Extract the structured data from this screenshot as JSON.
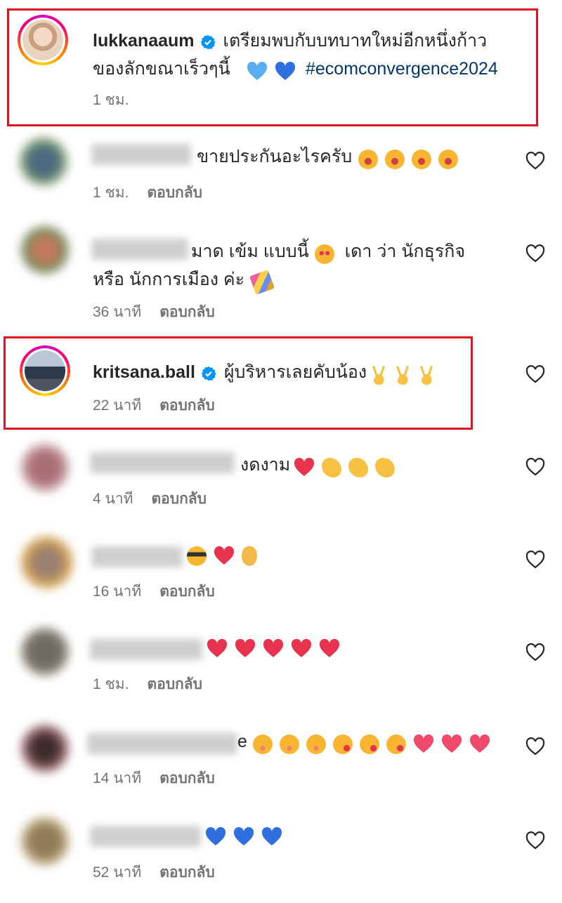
{
  "comments": [
    {
      "username": "lukkanaaum",
      "verified": true,
      "text_line1": "เตรียมพบกับบทบาทใหม่อีกหนึ่งก้าว",
      "text_line2": "ของลักขณาเร็วๆนี้",
      "hashtag": "#ecomconvergence2024",
      "time": "1 ชม.",
      "emojis": [
        "light-blue-heart",
        "blue-heart"
      ]
    },
    {
      "username": "",
      "text": "ขายประกันอะไรครับ",
      "time": "1 ชม.",
      "reply": "ตอบกลับ",
      "emojis": [
        "tears-of-joy",
        "tears-of-joy",
        "tears-of-joy",
        "tears-of-joy"
      ]
    },
    {
      "username": "",
      "text_line1": "มาด เข้ม แบบนี้",
      "text_line1b": "เดา ว่า นักธุรกิจ",
      "text_line2": "หรือ นักการเมือง ค่ะ",
      "time": "36 นาที",
      "reply": "ตอบกลับ",
      "emojis": [
        "heart-eyes",
        "party-popper"
      ]
    },
    {
      "username": "kritsana.ball",
      "verified": true,
      "text": "ผู้บริหารเลยคับน้อง",
      "time": "22 นาที",
      "reply": "ตอบกลับ",
      "emojis": [
        "victory-hand",
        "victory-hand",
        "victory-hand"
      ]
    },
    {
      "username": "",
      "text": "งดงาม",
      "time": "4 นาที",
      "reply": "ตอบกลับ",
      "emojis": [
        "red-heart",
        "clapping-hands",
        "clapping-hands",
        "clapping-hands"
      ]
    },
    {
      "username": "",
      "text": "",
      "time": "16 นาที",
      "reply": "ตอบกลับ",
      "emojis": [
        "smiling-sunglasses",
        "red-heart",
        "ok-hand"
      ]
    },
    {
      "username": "",
      "text": "",
      "time": "1 ชม.",
      "reply": "ตอบกลับ",
      "emojis": [
        "red-heart",
        "red-heart",
        "red-heart",
        "red-heart",
        "red-heart"
      ]
    },
    {
      "username": "",
      "text": "e",
      "time": "14 นาที",
      "reply": "ตอบกลับ",
      "emojis": [
        "flushed",
        "flushed",
        "flushed",
        "kissing-face",
        "kissing-face",
        "kissing-face",
        "heart",
        "heart",
        "heart"
      ]
    },
    {
      "username": "",
      "text": "",
      "time": "52 นาที",
      "reply": "ตอบกลับ",
      "emojis": [
        "blue-heart",
        "blue-heart",
        "blue-heart"
      ]
    }
  ],
  "colors": {
    "highlight_box": "#e0141e",
    "verified": "#0095f6",
    "hashtag": "#00376b",
    "meta_text": "#737373"
  }
}
